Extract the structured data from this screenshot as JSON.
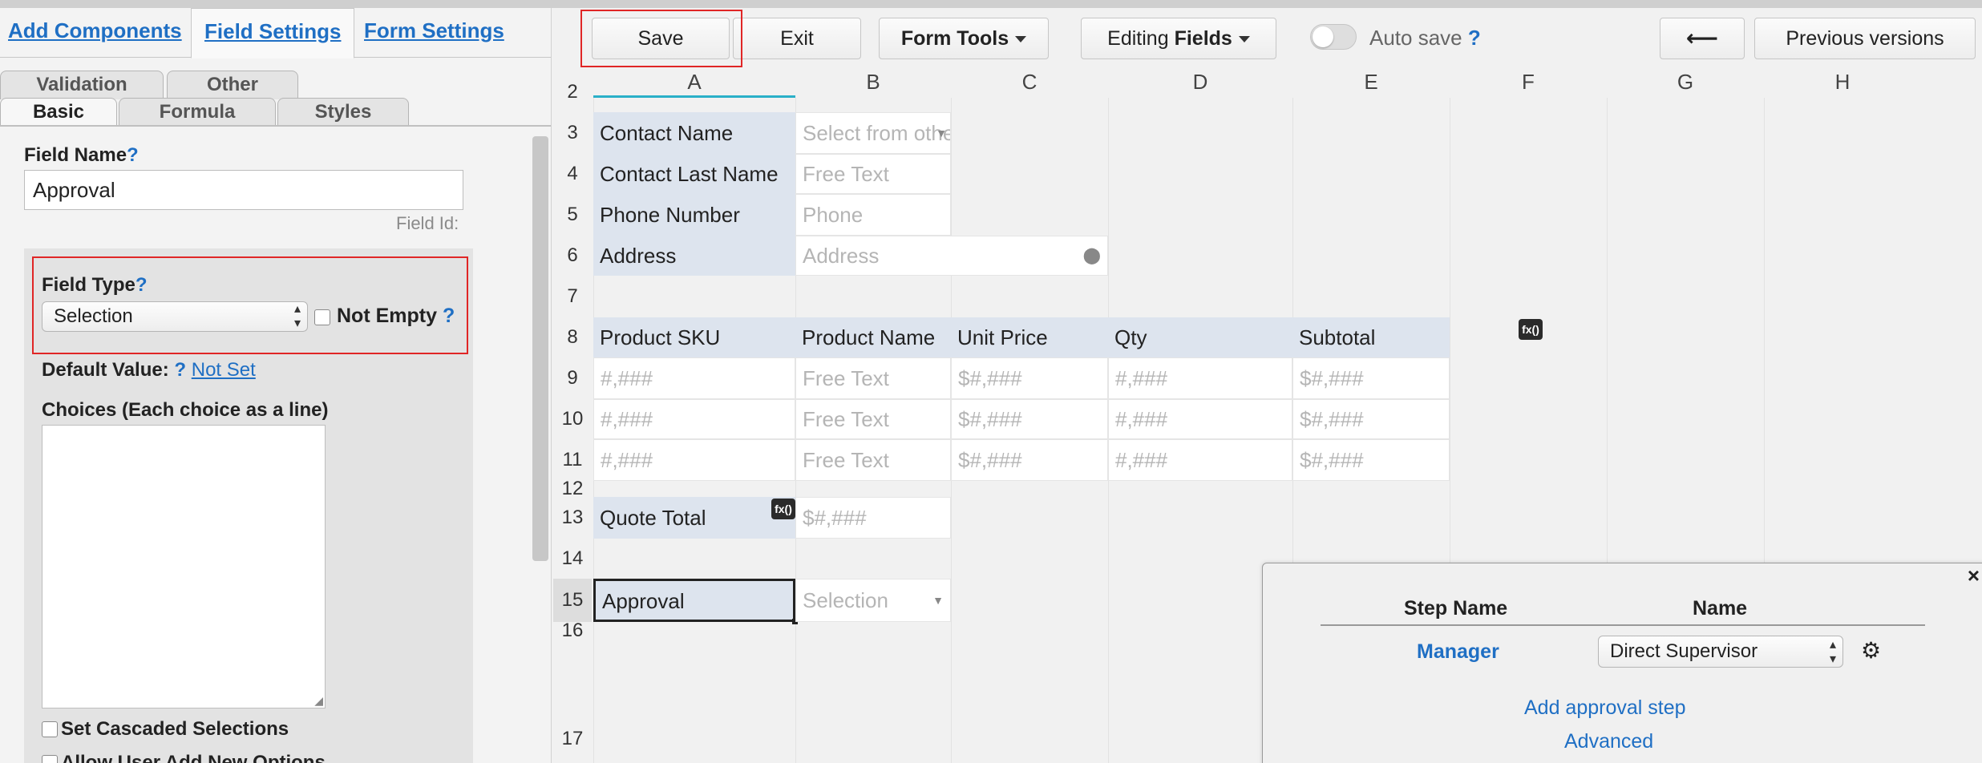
{
  "left_panel": {
    "main_tabs": [
      {
        "label": "Add Components"
      },
      {
        "label": "Field Settings"
      },
      {
        "label": "Form Settings"
      }
    ],
    "sub_tabs_row1": [
      {
        "label": "Validation"
      },
      {
        "label": "Other"
      }
    ],
    "sub_tabs_row2": [
      {
        "label": "Basic"
      },
      {
        "label": "Formula"
      },
      {
        "label": "Styles"
      }
    ],
    "field_name_label": "Field Name",
    "field_name_value": "Approval",
    "field_id_label": "Field Id:",
    "field_type_label": "Field Type",
    "field_type_value": "Selection",
    "not_empty_label": "Not Empty",
    "default_value_label": "Default Value:",
    "default_value_link": "Not Set",
    "choices_label": "Choices (Each choice as a line)",
    "cascaded_label": "Set Cascaded Selections",
    "allow_add_label": "Allow User Add New Options",
    "help_mark": "?"
  },
  "toolbar": {
    "save": "Save",
    "exit": "Exit",
    "form_tools": "Form Tools",
    "editing_prefix": "Editing",
    "editing_bold": "Fields",
    "auto_save": "Auto save",
    "back_arrow": "⟵",
    "previous_versions": "Previous versions"
  },
  "sheet": {
    "columns": [
      "A",
      "B",
      "C",
      "D",
      "E",
      "F",
      "G",
      "H"
    ],
    "rows": [
      "2",
      "3",
      "4",
      "5",
      "6",
      "7",
      "8",
      "9",
      "10",
      "11",
      "12",
      "13",
      "14",
      "15",
      "16",
      "17"
    ],
    "labels": {
      "contact_name": "Contact Name",
      "contact_last_name": "Contact Last Name",
      "phone_number": "Phone Number",
      "address": "Address",
      "quote_total": "Quote Total",
      "approval": "Approval"
    },
    "placeholders": {
      "select_other": "Select from other Sheet",
      "free_text": "Free Text",
      "phone": "Phone",
      "address": "Address",
      "money": "$#,###",
      "selection": "Selection"
    },
    "product_headers": [
      "Product SKU",
      "Product Name",
      "Unit Price",
      "Qty",
      "Subtotal"
    ],
    "product_rows": [
      [
        "#,###",
        "Free Text",
        "$#,###",
        "#,###",
        "$#,###"
      ],
      [
        "#,###",
        "Free Text",
        "$#,###",
        "#,###",
        "$#,###"
      ],
      [
        "#,###",
        "Free Text",
        "$#,###",
        "#,###",
        "$#,###"
      ]
    ],
    "fx_badge": "fx()"
  },
  "popup": {
    "close": "×",
    "col_step_name": "Step Name",
    "col_name": "Name",
    "step_label": "Manager",
    "step_value": "Direct Supervisor",
    "add_step": "Add approval step",
    "advanced": "Advanced"
  },
  "colors": {
    "link_blue": "#1f6fc4",
    "highlight_red": "#e02626",
    "label_cell_bg": "#dde4ee",
    "active_col_accent": "#2ab0c8"
  }
}
